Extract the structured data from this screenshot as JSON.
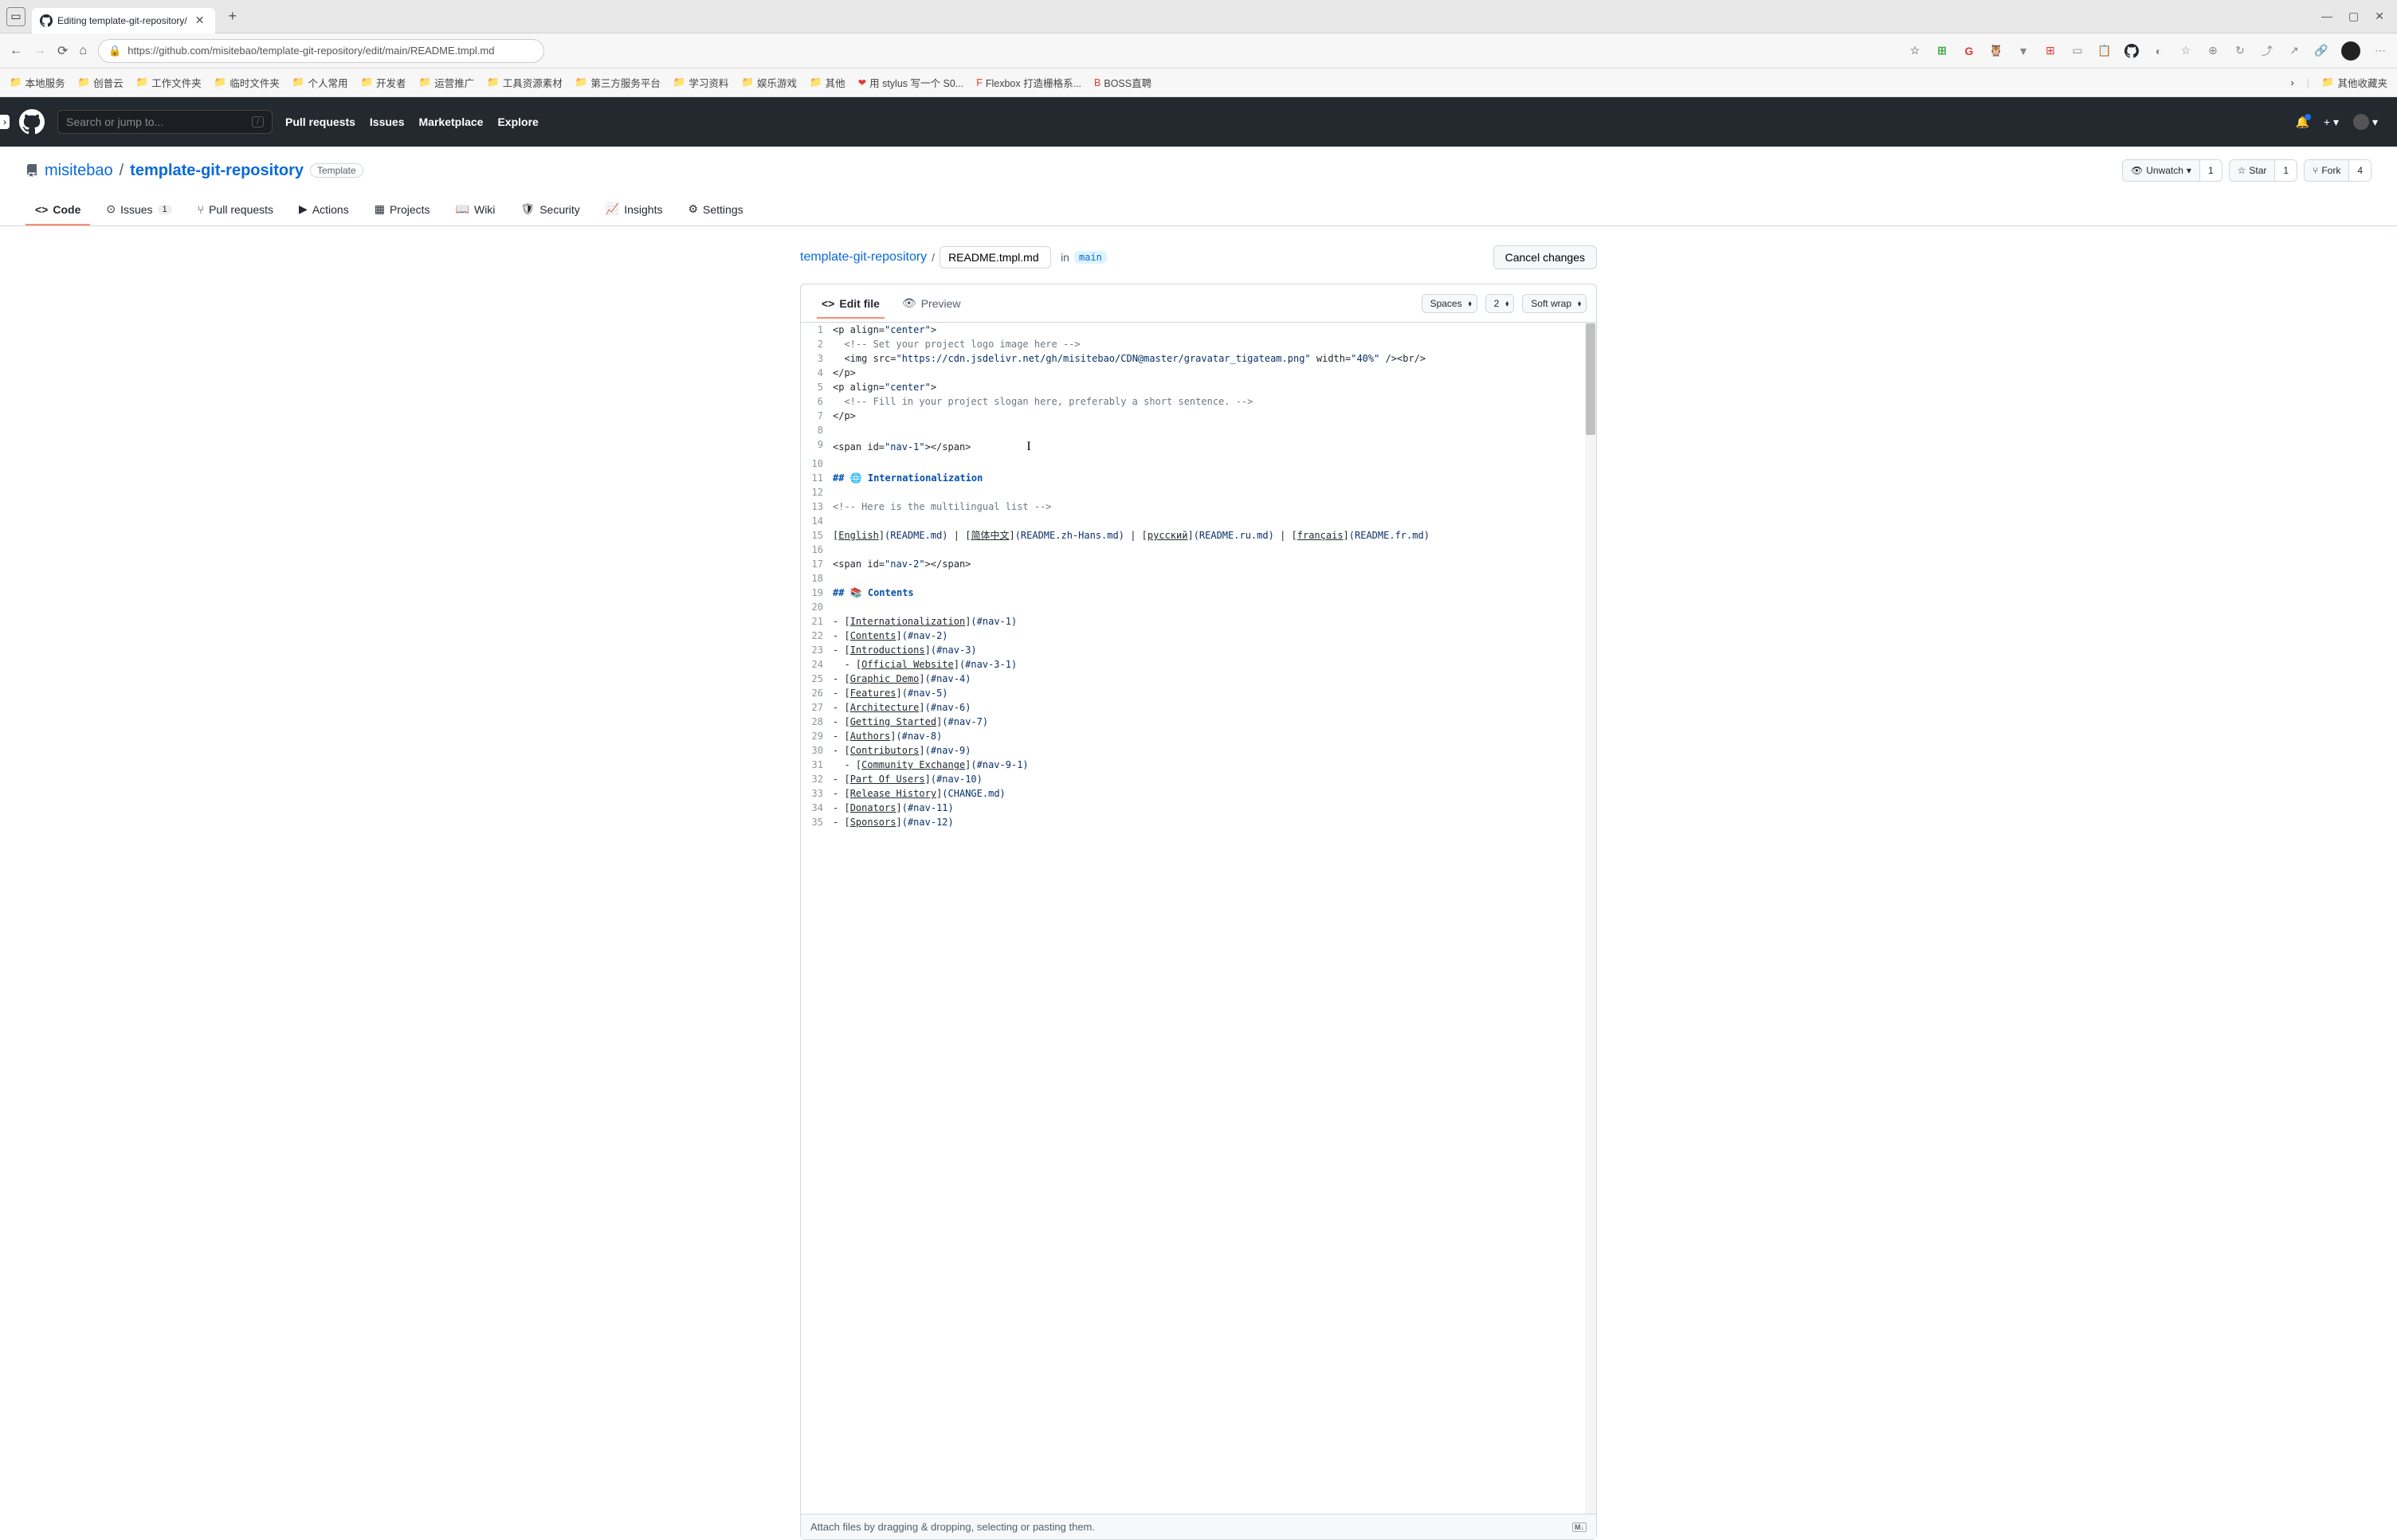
{
  "browser": {
    "tab_title": "Editing template-git-repository/",
    "url": "https://github.com/misitebao/template-git-repository/edit/main/README.tmpl.md"
  },
  "bookmarks": [
    "本地服务",
    "创普云",
    "工作文件夹",
    "临时文件夹",
    "个人常用",
    "开发者",
    "运营推广",
    "工具资源素材",
    "第三方服务平台",
    "学习资料",
    "娱乐游戏",
    "其他"
  ],
  "bookmarks_special": [
    {
      "label": "用 stylus 写一个 S0...",
      "icon": "❤"
    },
    {
      "label": "Flexbox 打造栅格系...",
      "icon": "F"
    },
    {
      "label": "BOSS直聘",
      "icon": "B"
    }
  ],
  "bookmarks_right": "其他收藏夹",
  "github": {
    "search_placeholder": "Search or jump to...",
    "nav": [
      "Pull requests",
      "Issues",
      "Marketplace",
      "Explore"
    ]
  },
  "repo": {
    "owner": "misitebao",
    "name": "template-git-repository",
    "template_label": "Template",
    "unwatch": "Unwatch",
    "unwatch_count": "1",
    "star": "Star",
    "star_count": "1",
    "fork": "Fork",
    "fork_count": "4"
  },
  "tabs": [
    {
      "label": "Code"
    },
    {
      "label": "Issues",
      "count": "1"
    },
    {
      "label": "Pull requests"
    },
    {
      "label": "Actions"
    },
    {
      "label": "Projects"
    },
    {
      "label": "Wiki"
    },
    {
      "label": "Security"
    },
    {
      "label": "Insights"
    },
    {
      "label": "Settings"
    }
  ],
  "breadcrumb": {
    "root": "template-git-repository",
    "filename": "README.tmpl.md",
    "in": "in",
    "branch": "main",
    "cancel": "Cancel changes"
  },
  "editor": {
    "tab_edit": "Edit file",
    "tab_preview": "Preview",
    "opt_spaces": "Spaces",
    "opt_indent": "2",
    "opt_wrap": "Soft wrap",
    "footer": "Attach files by dragging & dropping, selecting or pasting them.",
    "md_label": "M↓"
  },
  "code_lines": [
    {
      "n": 1,
      "seg": [
        [
          "t",
          "<p align="
        ],
        [
          "s",
          "\"center\""
        ],
        [
          "t",
          ">"
        ]
      ]
    },
    {
      "n": 2,
      "seg": [
        [
          "c",
          "  <!-- Set your project logo image here -->"
        ]
      ]
    },
    {
      "n": 3,
      "seg": [
        [
          "t",
          "  <img src="
        ],
        [
          "s",
          "\"https://cdn.jsdelivr.net/gh/misitebao/CDN@master/gravatar_tigateam.png\""
        ],
        [
          "t",
          " width="
        ],
        [
          "s",
          "\"40%\""
        ],
        [
          "t",
          " /><br/>"
        ]
      ]
    },
    {
      "n": 4,
      "seg": [
        [
          "t",
          "</p>"
        ]
      ]
    },
    {
      "n": 5,
      "seg": [
        [
          "t",
          "<p align="
        ],
        [
          "s",
          "\"center\""
        ],
        [
          "t",
          ">"
        ]
      ]
    },
    {
      "n": 6,
      "seg": [
        [
          "c",
          "  <!-- Fill in your project slogan here, preferably a short sentence. -->"
        ]
      ]
    },
    {
      "n": 7,
      "seg": [
        [
          "t",
          "</p>"
        ]
      ]
    },
    {
      "n": 8,
      "seg": [
        [
          "t",
          ""
        ]
      ]
    },
    {
      "n": 9,
      "seg": [
        [
          "t",
          "<span id="
        ],
        [
          "s",
          "\"nav-1\""
        ],
        [
          "t",
          "></span>"
        ]
      ],
      "cursor": true
    },
    {
      "n": 10,
      "seg": [
        [
          "t",
          ""
        ]
      ]
    },
    {
      "n": 11,
      "seg": [
        [
          "h",
          "## "
        ],
        [
          "t",
          "🌐 "
        ],
        [
          "h",
          "Internationalization"
        ]
      ]
    },
    {
      "n": 12,
      "seg": [
        [
          "t",
          ""
        ]
      ]
    },
    {
      "n": 13,
      "seg": [
        [
          "c",
          "<!-- Here is the multilingual list -->"
        ]
      ]
    },
    {
      "n": 14,
      "seg": [
        [
          "t",
          ""
        ]
      ]
    },
    {
      "n": 15,
      "seg": [
        [
          "t",
          "["
        ],
        [
          "l",
          "English"
        ],
        [
          "t",
          "]"
        ],
        [
          "u",
          "(README.md)"
        ],
        [
          "t",
          " | ["
        ],
        [
          "l",
          "简体中文"
        ],
        [
          "t",
          "]"
        ],
        [
          "u",
          "(README.zh-Hans.md)"
        ],
        [
          "t",
          " | ["
        ],
        [
          "l",
          "русский"
        ],
        [
          "t",
          "]"
        ],
        [
          "u",
          "(README.ru.md)"
        ],
        [
          "t",
          " | ["
        ],
        [
          "l",
          "français"
        ],
        [
          "t",
          "]"
        ],
        [
          "u",
          "(README.fr.md)"
        ]
      ]
    },
    {
      "n": 16,
      "seg": [
        [
          "t",
          ""
        ]
      ]
    },
    {
      "n": 17,
      "seg": [
        [
          "t",
          "<span id="
        ],
        [
          "s",
          "\"nav-2\""
        ],
        [
          "t",
          "></span>"
        ]
      ]
    },
    {
      "n": 18,
      "seg": [
        [
          "t",
          ""
        ]
      ]
    },
    {
      "n": 19,
      "seg": [
        [
          "h",
          "## "
        ],
        [
          "t",
          "📚 "
        ],
        [
          "h",
          "Contents"
        ]
      ]
    },
    {
      "n": 20,
      "seg": [
        [
          "t",
          ""
        ]
      ]
    },
    {
      "n": 21,
      "seg": [
        [
          "t",
          "- ["
        ],
        [
          "l",
          "Internationalization"
        ],
        [
          "t",
          "]"
        ],
        [
          "u",
          "(#nav-1)"
        ]
      ]
    },
    {
      "n": 22,
      "seg": [
        [
          "t",
          "- ["
        ],
        [
          "l",
          "Contents"
        ],
        [
          "t",
          "]"
        ],
        [
          "u",
          "(#nav-2)"
        ]
      ]
    },
    {
      "n": 23,
      "seg": [
        [
          "t",
          "- ["
        ],
        [
          "l",
          "Introductions"
        ],
        [
          "t",
          "]"
        ],
        [
          "u",
          "(#nav-3)"
        ]
      ]
    },
    {
      "n": 24,
      "seg": [
        [
          "t",
          "  - ["
        ],
        [
          "l",
          "Official Website"
        ],
        [
          "t",
          "]"
        ],
        [
          "u",
          "(#nav-3-1)"
        ]
      ]
    },
    {
      "n": 25,
      "seg": [
        [
          "t",
          "- ["
        ],
        [
          "l",
          "Graphic Demo"
        ],
        [
          "t",
          "]"
        ],
        [
          "u",
          "(#nav-4)"
        ]
      ]
    },
    {
      "n": 26,
      "seg": [
        [
          "t",
          "- ["
        ],
        [
          "l",
          "Features"
        ],
        [
          "t",
          "]"
        ],
        [
          "u",
          "(#nav-5)"
        ]
      ]
    },
    {
      "n": 27,
      "seg": [
        [
          "t",
          "- ["
        ],
        [
          "l",
          "Architecture"
        ],
        [
          "t",
          "]"
        ],
        [
          "u",
          "(#nav-6)"
        ]
      ]
    },
    {
      "n": 28,
      "seg": [
        [
          "t",
          "- ["
        ],
        [
          "l",
          "Getting Started"
        ],
        [
          "t",
          "]"
        ],
        [
          "u",
          "(#nav-7)"
        ]
      ]
    },
    {
      "n": 29,
      "seg": [
        [
          "t",
          "- ["
        ],
        [
          "l",
          "Authors"
        ],
        [
          "t",
          "]"
        ],
        [
          "u",
          "(#nav-8)"
        ]
      ]
    },
    {
      "n": 30,
      "seg": [
        [
          "t",
          "- ["
        ],
        [
          "l",
          "Contributors"
        ],
        [
          "t",
          "]"
        ],
        [
          "u",
          "(#nav-9)"
        ]
      ]
    },
    {
      "n": 31,
      "seg": [
        [
          "t",
          "  - ["
        ],
        [
          "l",
          "Community Exchange"
        ],
        [
          "t",
          "]"
        ],
        [
          "u",
          "(#nav-9-1)"
        ]
      ]
    },
    {
      "n": 32,
      "seg": [
        [
          "t",
          "- ["
        ],
        [
          "l",
          "Part Of Users"
        ],
        [
          "t",
          "]"
        ],
        [
          "u",
          "(#nav-10)"
        ]
      ]
    },
    {
      "n": 33,
      "seg": [
        [
          "t",
          "- ["
        ],
        [
          "l",
          "Release History"
        ],
        [
          "t",
          "]"
        ],
        [
          "u",
          "(CHANGE.md)"
        ]
      ]
    },
    {
      "n": 34,
      "seg": [
        [
          "t",
          "- ["
        ],
        [
          "l",
          "Donators"
        ],
        [
          "t",
          "]"
        ],
        [
          "u",
          "(#nav-11)"
        ]
      ]
    },
    {
      "n": 35,
      "seg": [
        [
          "t",
          "- ["
        ],
        [
          "l",
          "Sponsors"
        ],
        [
          "t",
          "]"
        ],
        [
          "u",
          "(#nav-12)"
        ]
      ]
    }
  ]
}
